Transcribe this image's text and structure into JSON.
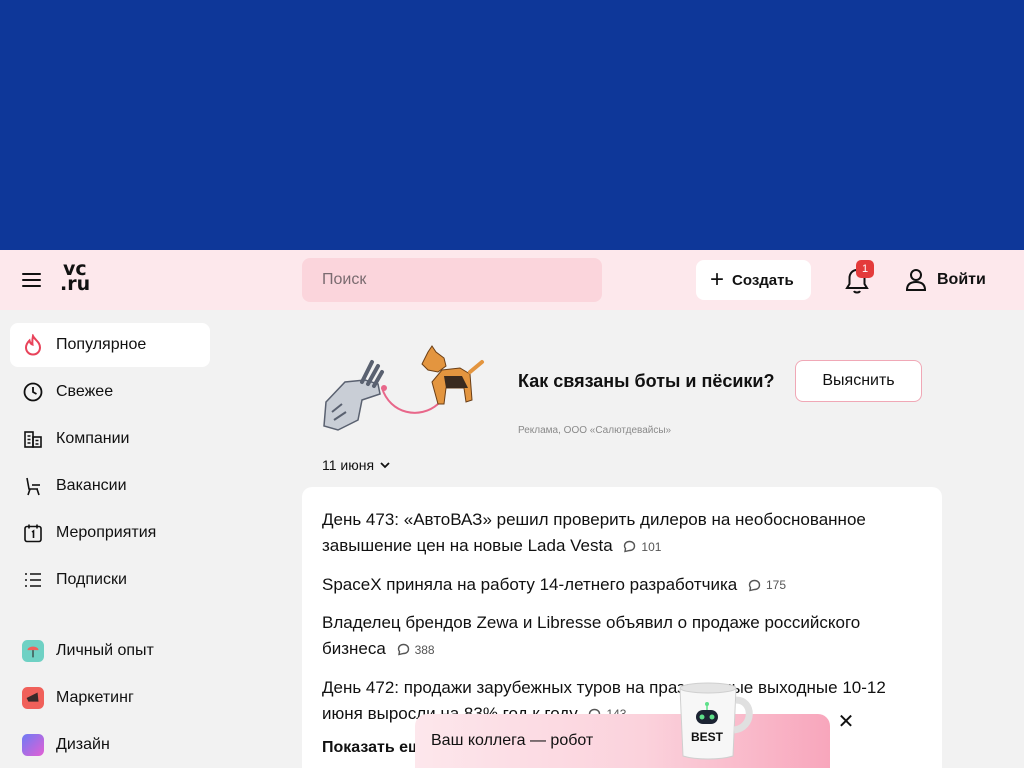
{
  "header": {
    "logo_line1": "vc",
    "logo_line2": ".ru",
    "search_placeholder": "Поиск",
    "create_label": "Создать",
    "notifications_count": "1",
    "login_label": "Войти"
  },
  "sidebar": {
    "items": [
      {
        "label": "Популярное",
        "icon": "flame-icon",
        "active": true
      },
      {
        "label": "Свежее",
        "icon": "clock-icon"
      },
      {
        "label": "Компании",
        "icon": "buildings-icon"
      },
      {
        "label": "Вакансии",
        "icon": "chair-icon"
      },
      {
        "label": "Мероприятия",
        "icon": "calendar-icon"
      },
      {
        "label": "Подписки",
        "icon": "list-icon"
      }
    ],
    "topics": [
      {
        "label": "Личный опыт",
        "icon": "parachute-icon",
        "color": "#6fd1c4"
      },
      {
        "label": "Маркетинг",
        "icon": "megaphone-icon",
        "color": "#f0605a"
      },
      {
        "label": "Дизайн",
        "icon": "design-icon",
        "color": "#b56cf2"
      }
    ]
  },
  "promo": {
    "title": "Как связаны боты и пёсики?",
    "button": "Выяснить",
    "ad_label": "Реклама, ООО «Салютдевайсы»"
  },
  "feed": {
    "date": "11 июня",
    "news": [
      {
        "title": "День 473: «АвтоВАЗ» решил проверить дилеров на необоснованное завышение цен на новые Lada Vesta",
        "comments": "101"
      },
      {
        "title": "SpaceX приняла на работу 14-летнего разработчика",
        "comments": "175"
      },
      {
        "title": "Владелец брендов Zewa и Libresse объявил о продаже российского бизнеса",
        "comments": "388"
      },
      {
        "title": "День 472: продажи зарубежных туров на праздничные выходные 10-12 июня выросли на 83% год к году",
        "comments": "143"
      }
    ],
    "show_more": "Показать еще"
  },
  "toast": {
    "text": "Ваш коллега — робот",
    "mug_text": "BEST"
  },
  "colors": {
    "banner": "#0e3799",
    "header_bg": "#fde8ec",
    "badge": "#e43b3b"
  }
}
